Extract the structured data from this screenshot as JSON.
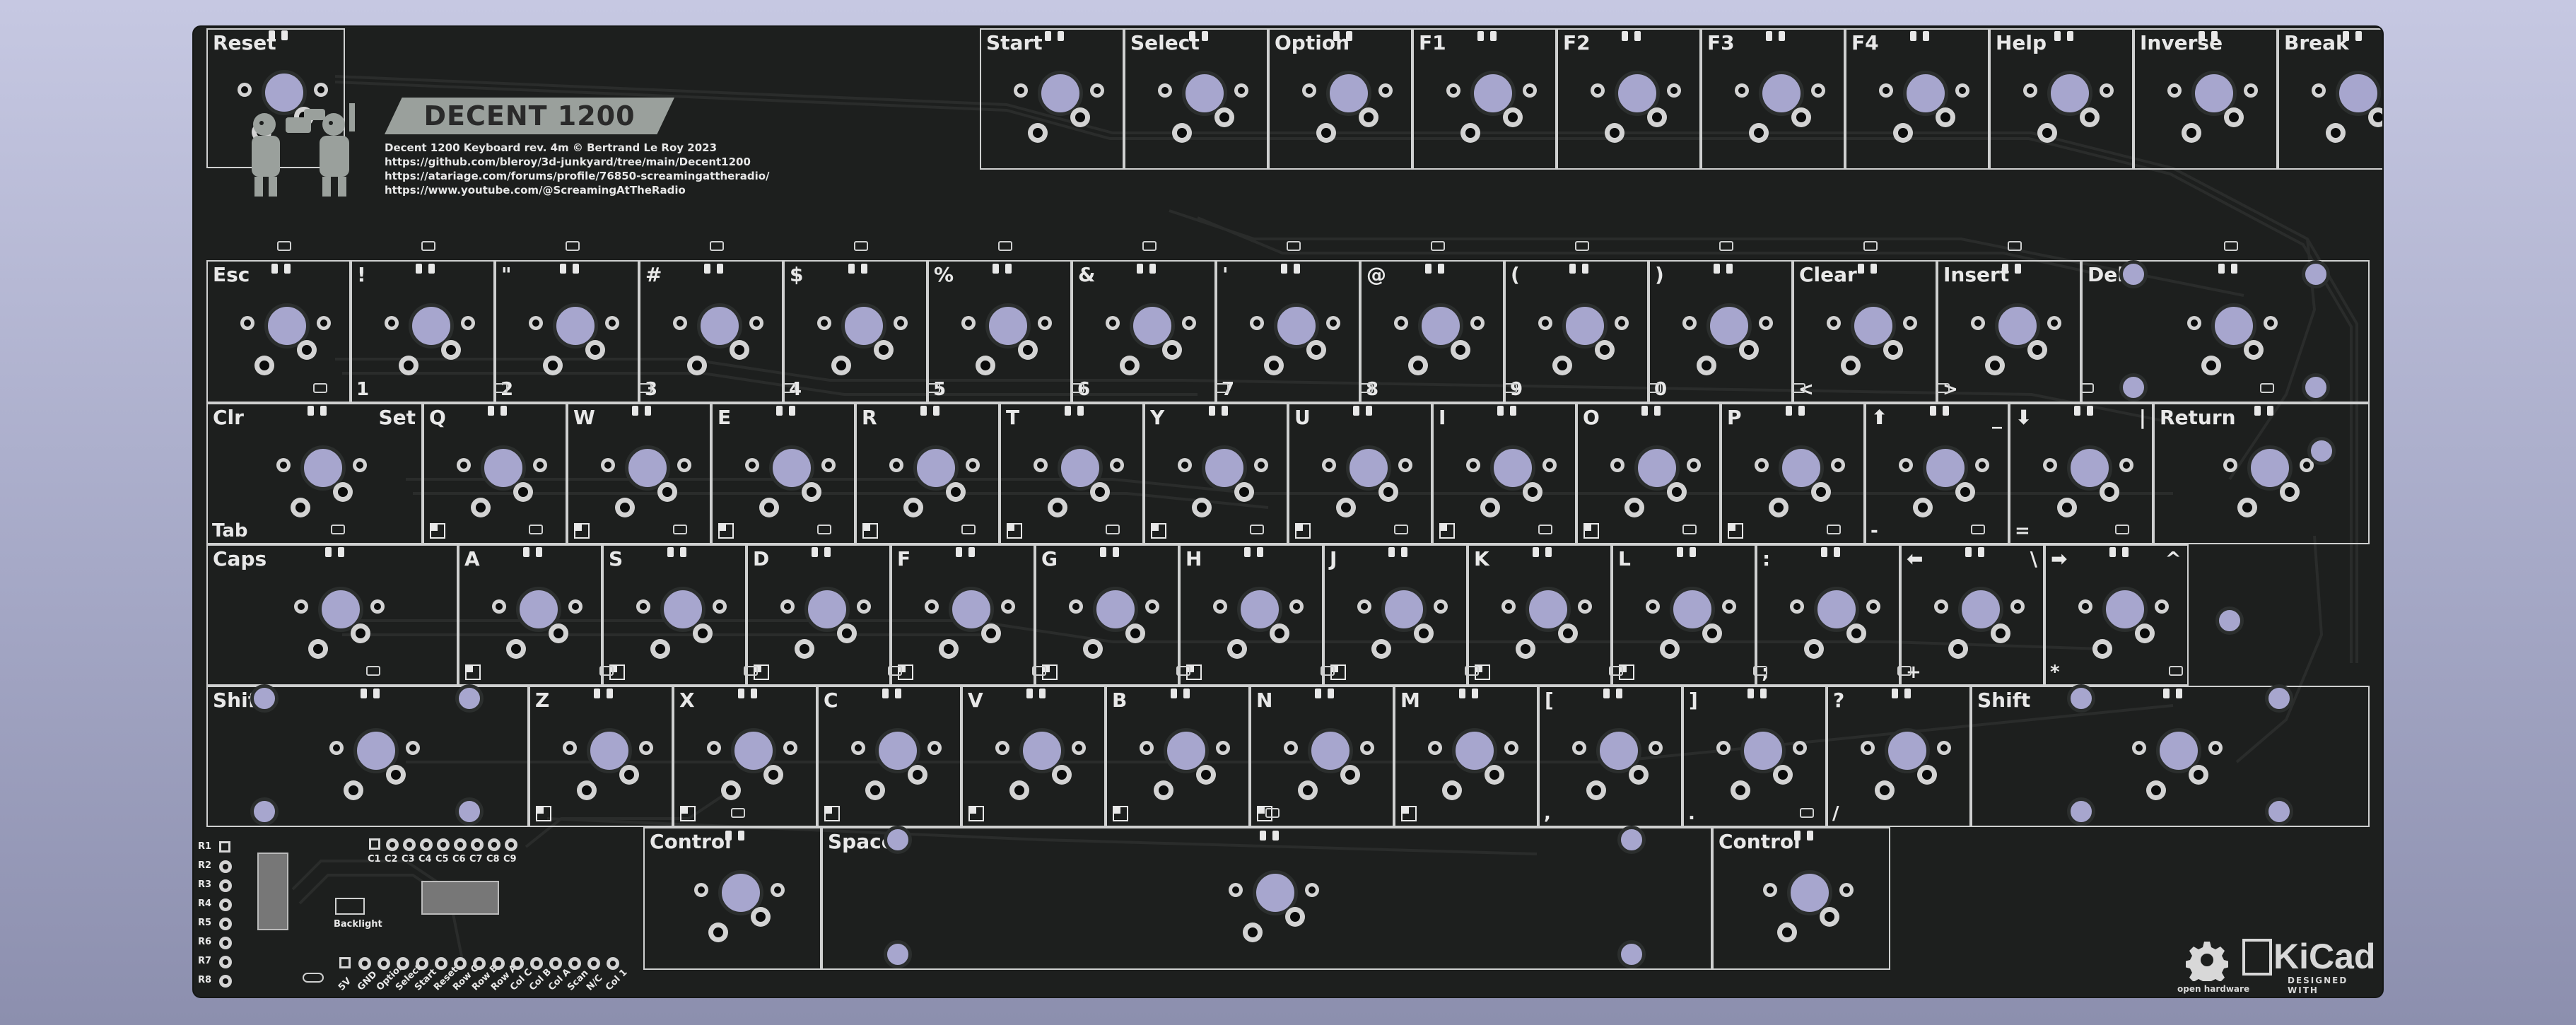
{
  "board": {
    "title": "DECENT 1200",
    "info_lines": [
      "Decent 1200 Keyboard rev. 4m © Bertrand Le Roy 2023",
      "https://github.com/bleroy/3d-junkyard/tree/main/Decent1200",
      "https://atariage.com/forums/profile/76850-screamingattheradio/",
      "https://www.youtube.com/@ScreamingAtTheRadio"
    ]
  },
  "keys": {
    "reset": "Reset",
    "fn_row": [
      "Start",
      "Select",
      "Option",
      "F1",
      "F2",
      "F3",
      "F4",
      "Help",
      "Inverse",
      "Break"
    ],
    "num_row": [
      {
        "top": "Esc",
        "bot": ""
      },
      {
        "top": "!",
        "bot": "1"
      },
      {
        "top": "\"",
        "bot": "2"
      },
      {
        "top": "#",
        "bot": "3"
      },
      {
        "top": "$",
        "bot": "4"
      },
      {
        "top": "%",
        "bot": "5"
      },
      {
        "top": "&",
        "bot": "6"
      },
      {
        "top": "'",
        "bot": "7"
      },
      {
        "top": "@",
        "bot": "8"
      },
      {
        "top": "(",
        "bot": "9"
      },
      {
        "top": ")",
        "bot": "0"
      },
      {
        "top": "Clear",
        "bot": "<"
      },
      {
        "top": "Insert",
        "bot": ">"
      },
      {
        "top": "Del",
        "bot": ""
      }
    ],
    "tab_row": [
      {
        "top": "Clr",
        "topr": "Set",
        "bot": "Tab"
      },
      {
        "top": "Q",
        "topr": "",
        "bot": ""
      },
      {
        "top": "W",
        "topr": "",
        "bot": ""
      },
      {
        "top": "E",
        "topr": "",
        "bot": ""
      },
      {
        "top": "R",
        "topr": "",
        "bot": ""
      },
      {
        "top": "T",
        "topr": "",
        "bot": ""
      },
      {
        "top": "Y",
        "topr": "",
        "bot": ""
      },
      {
        "top": "U",
        "topr": "",
        "bot": ""
      },
      {
        "top": "I",
        "topr": "",
        "bot": ""
      },
      {
        "top": "O",
        "topr": "",
        "bot": ""
      },
      {
        "top": "P",
        "topr": "",
        "bot": ""
      },
      {
        "top": "⬆",
        "topr": "_",
        "bot": "-"
      },
      {
        "top": "⬇",
        "topr": "|",
        "bot": "="
      },
      {
        "top": "Return",
        "topr": "",
        "bot": ""
      }
    ],
    "home_row": [
      {
        "top": "Caps",
        "topr": "",
        "bot": ""
      },
      {
        "top": "A",
        "topr": "",
        "bot": ""
      },
      {
        "top": "S",
        "topr": "",
        "bot": ""
      },
      {
        "top": "D",
        "topr": "",
        "bot": ""
      },
      {
        "top": "F",
        "topr": "",
        "bot": ""
      },
      {
        "top": "G",
        "topr": "",
        "bot": ""
      },
      {
        "top": "H",
        "topr": "",
        "bot": ""
      },
      {
        "top": "J",
        "topr": "",
        "bot": ""
      },
      {
        "top": "K",
        "topr": "",
        "bot": ""
      },
      {
        "top": "L",
        "topr": "",
        "bot": ""
      },
      {
        "top": ":",
        "topr": "",
        "bot": ";"
      },
      {
        "top": "⬅",
        "topr": "\\",
        "bot": "+"
      },
      {
        "top": "➡",
        "topr": "^",
        "bot": "*"
      }
    ],
    "shift_row": [
      {
        "top": "Shift",
        "bot": ""
      },
      {
        "top": "Z",
        "bot": ""
      },
      {
        "top": "X",
        "bot": ""
      },
      {
        "top": "C",
        "bot": ""
      },
      {
        "top": "V",
        "bot": ""
      },
      {
        "top": "B",
        "bot": ""
      },
      {
        "top": "N",
        "bot": ""
      },
      {
        "top": "M",
        "bot": ""
      },
      {
        "top": "[",
        "bot": ","
      },
      {
        "top": "]",
        "bot": "."
      },
      {
        "top": "?",
        "bot": "/"
      },
      {
        "top": "Shift",
        "bot": ""
      }
    ],
    "bottom_row": [
      "Control",
      "Space",
      "Control"
    ]
  },
  "header_pins": {
    "rows": [
      "R1",
      "R2",
      "R3",
      "R4",
      "R5",
      "R6",
      "R7",
      "R8"
    ],
    "cols": [
      "C1",
      "C2",
      "C3",
      "C4",
      "C5",
      "C6",
      "C7",
      "C8",
      "C9"
    ],
    "backlight": "Backlight",
    "bottom_pins": [
      "5V",
      "GND",
      "Option",
      "Select",
      "Start",
      "Reset",
      "Row C",
      "Row B",
      "Row A",
      "Col C",
      "Col B",
      "Col A",
      "Scan",
      "N/C",
      "Col 1"
    ]
  },
  "logos": {
    "kicad": "KiCad",
    "kicad_sub": "DESIGNED WITH",
    "oshw": "open hardware"
  },
  "colors": {
    "background": "#a6a9c7",
    "pcb": "#1d1f1e",
    "silkscreen": "#e8e8e8",
    "switch_hole": "#a7a6ce"
  }
}
